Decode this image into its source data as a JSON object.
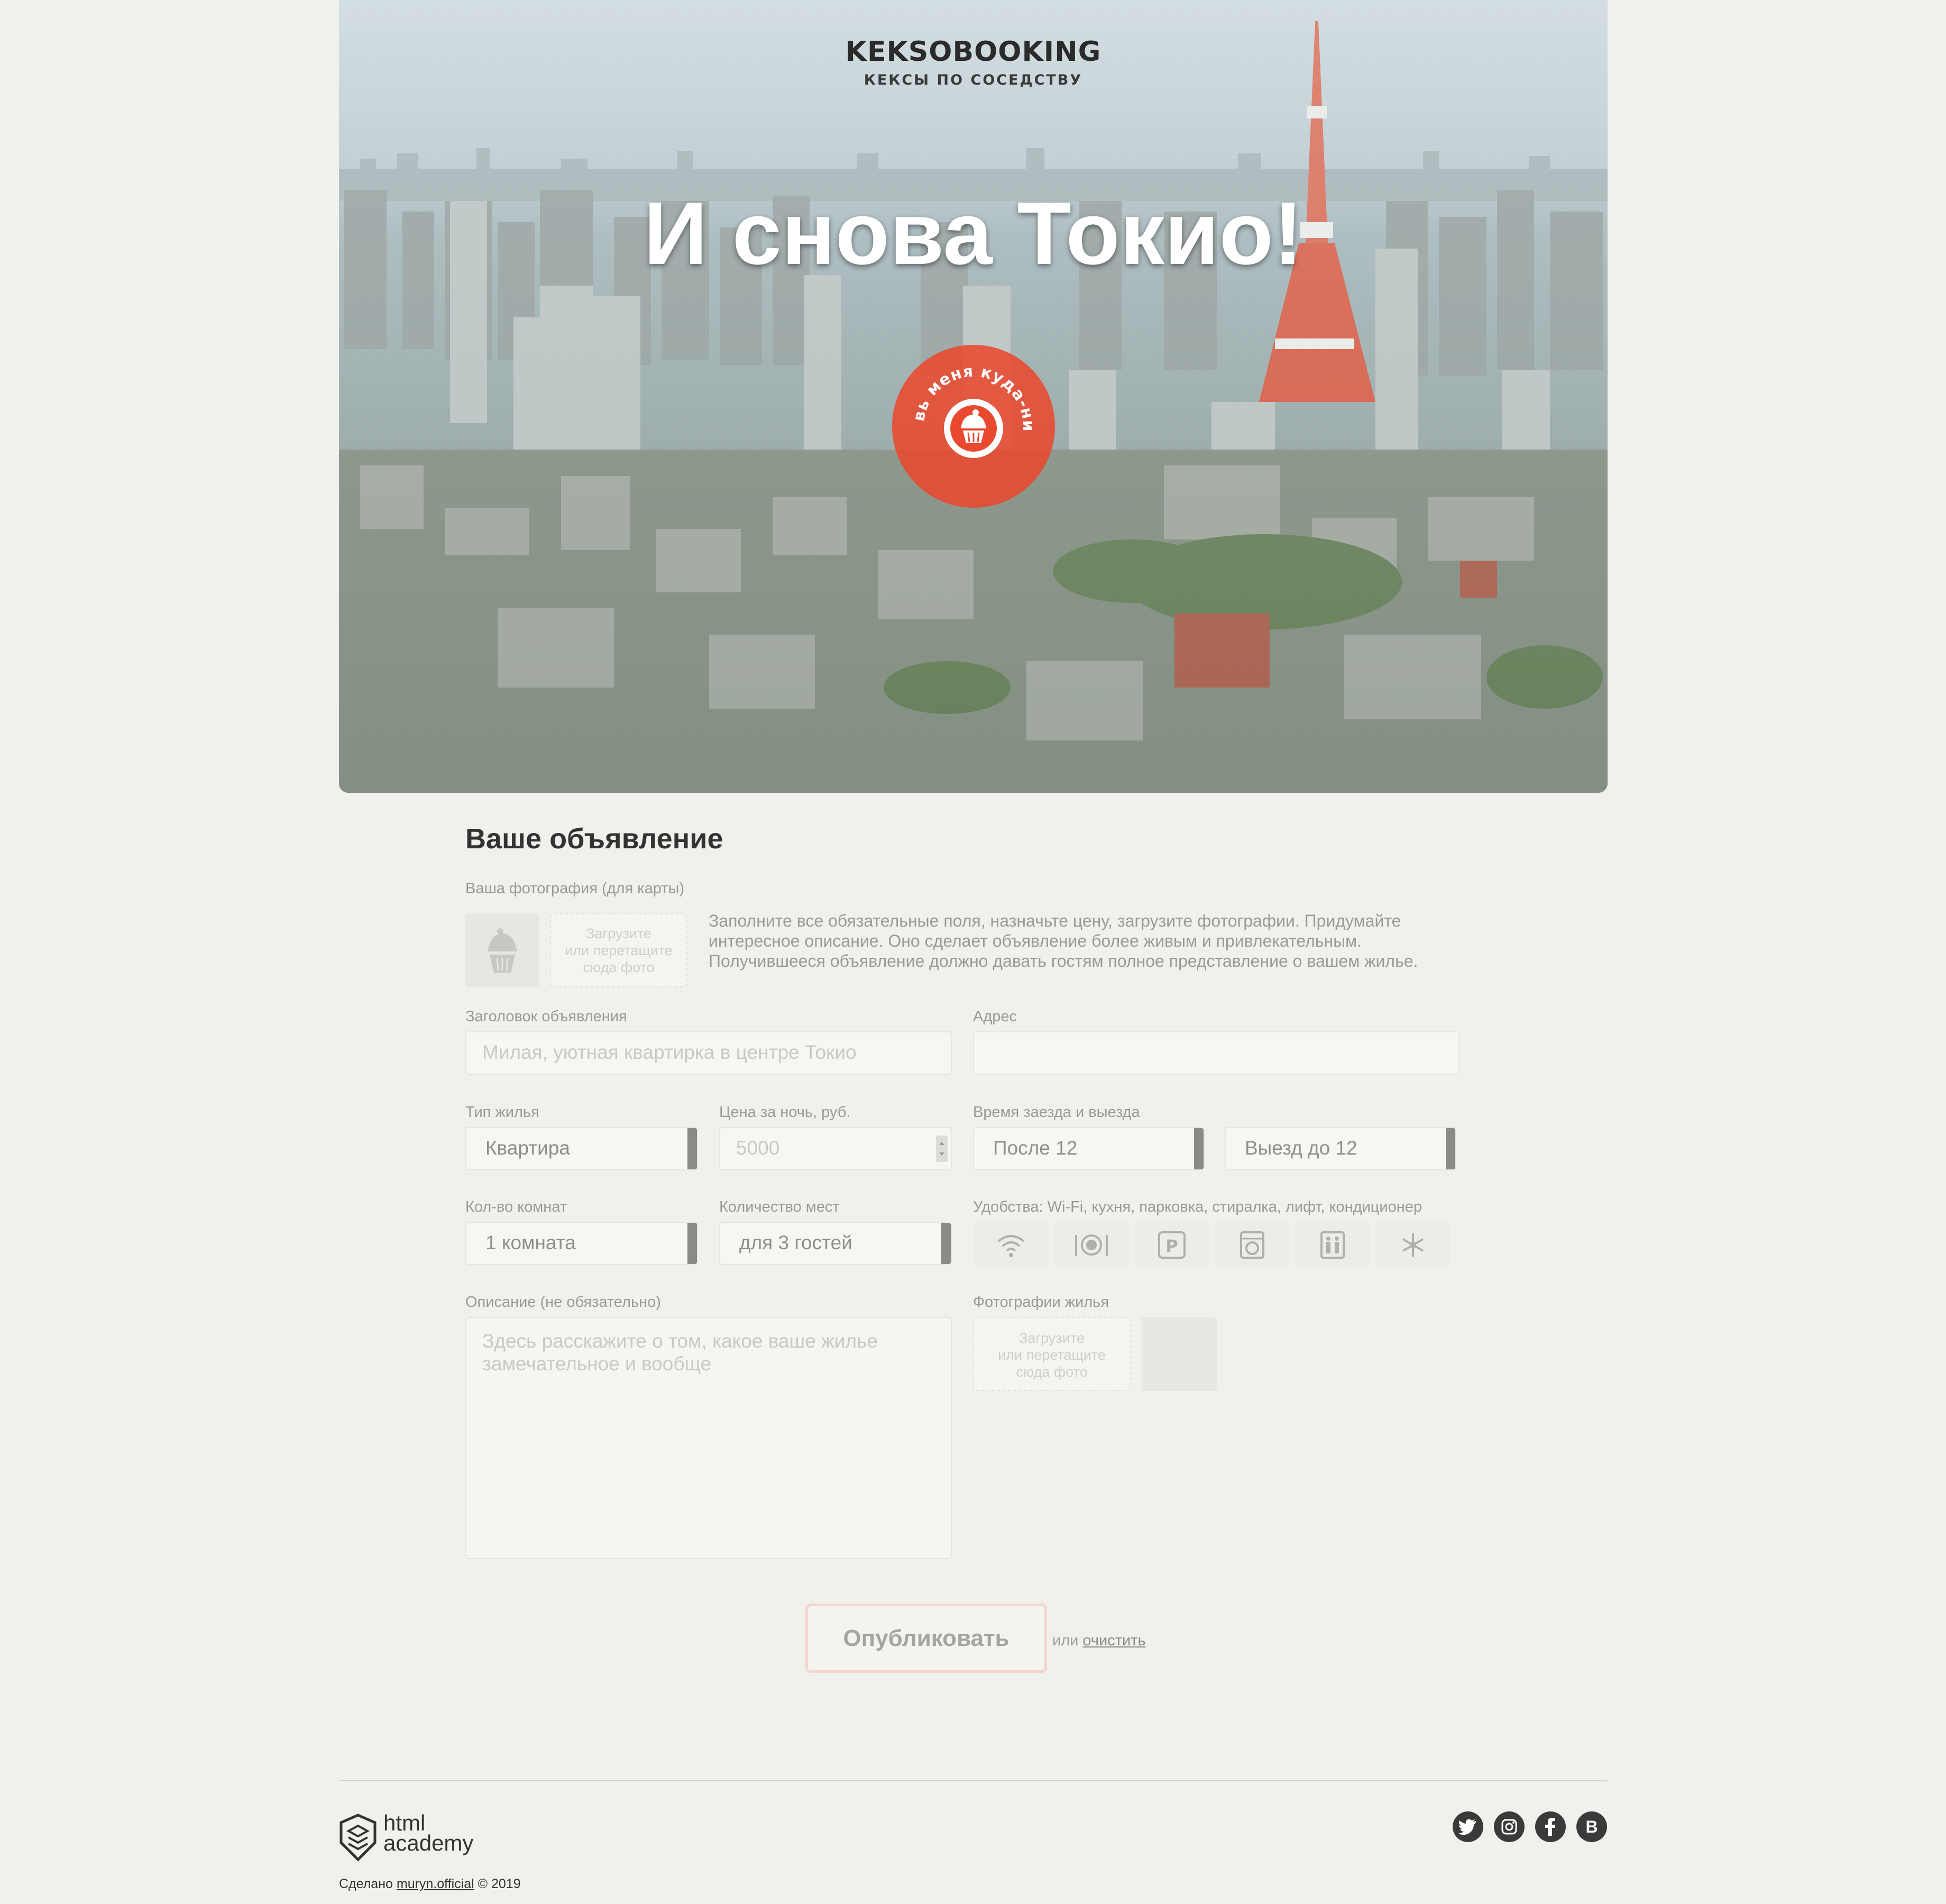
{
  "header": {
    "brand": "KEKSOBOOKING",
    "tagline": "КЕКСЫ ПО СОСЕДСТВУ",
    "hero_title": "И снова Токио!",
    "pin_text": "Поставь меня куда-нибудь"
  },
  "form": {
    "title": "Ваше объявление",
    "avatar_label": "Ваша фотография (для карты)",
    "avatar_drop": [
      "Загрузите",
      "или перетащите",
      "сюда фото"
    ],
    "hint": "Заполните все обязательные поля, назначьте цену, загрузите фотографии. Придумайте интересное описание. Оно сделает объявление более живым и привлекательным. Получившееся объявление должно давать гостям полное представление о вашем жилье.",
    "title_label": "Заголовок объявления",
    "title_placeholder": "Милая, уютная квартирка в центре Токио",
    "address_label": "Адрес",
    "address_value": "",
    "type_label": "Тип жилья",
    "type_value": "Квартира",
    "price_label": "Цена за ночь, руб.",
    "price_placeholder": "5000",
    "time_label": "Время заезда и выезда",
    "timein_value": "После 12",
    "timeout_value": "Выезд до 12",
    "rooms_label": "Кол-во комнат",
    "rooms_value": "1 комната",
    "capacity_label": "Количество мест",
    "capacity_value": "для 3 гостей",
    "features_label": "Удобства: Wi-Fi, кухня, парковка, стиралка, лифт, кондиционер",
    "features": [
      "wifi-icon",
      "kitchen-icon",
      "parking-icon",
      "washer-icon",
      "elevator-icon",
      "conditioner-icon"
    ],
    "description_label": "Описание (не обязательно)",
    "description_placeholder": "Здесь расскажите о том, какое ваше жилье замечательное и вообще",
    "photos_label": "Фотографии жилья",
    "photos_drop": [
      "Загрузите",
      "или перетащите",
      "сюда фото"
    ],
    "submit": "Опубликовать",
    "or": "или",
    "reset": "очистить"
  },
  "footer": {
    "academy_line1": "html",
    "academy_line2": "academy",
    "made_by": "Сделано",
    "author": "muryn.official",
    "year": "© 2019",
    "social": [
      "twitter-icon",
      "instagram-icon",
      "facebook-icon",
      "vk-icon"
    ],
    "vk_letter": "B"
  },
  "colors": {
    "background": "#f0f0ec",
    "accent": "#e8492f",
    "submit_border": "#f5d6cf",
    "dark": "#333333"
  }
}
